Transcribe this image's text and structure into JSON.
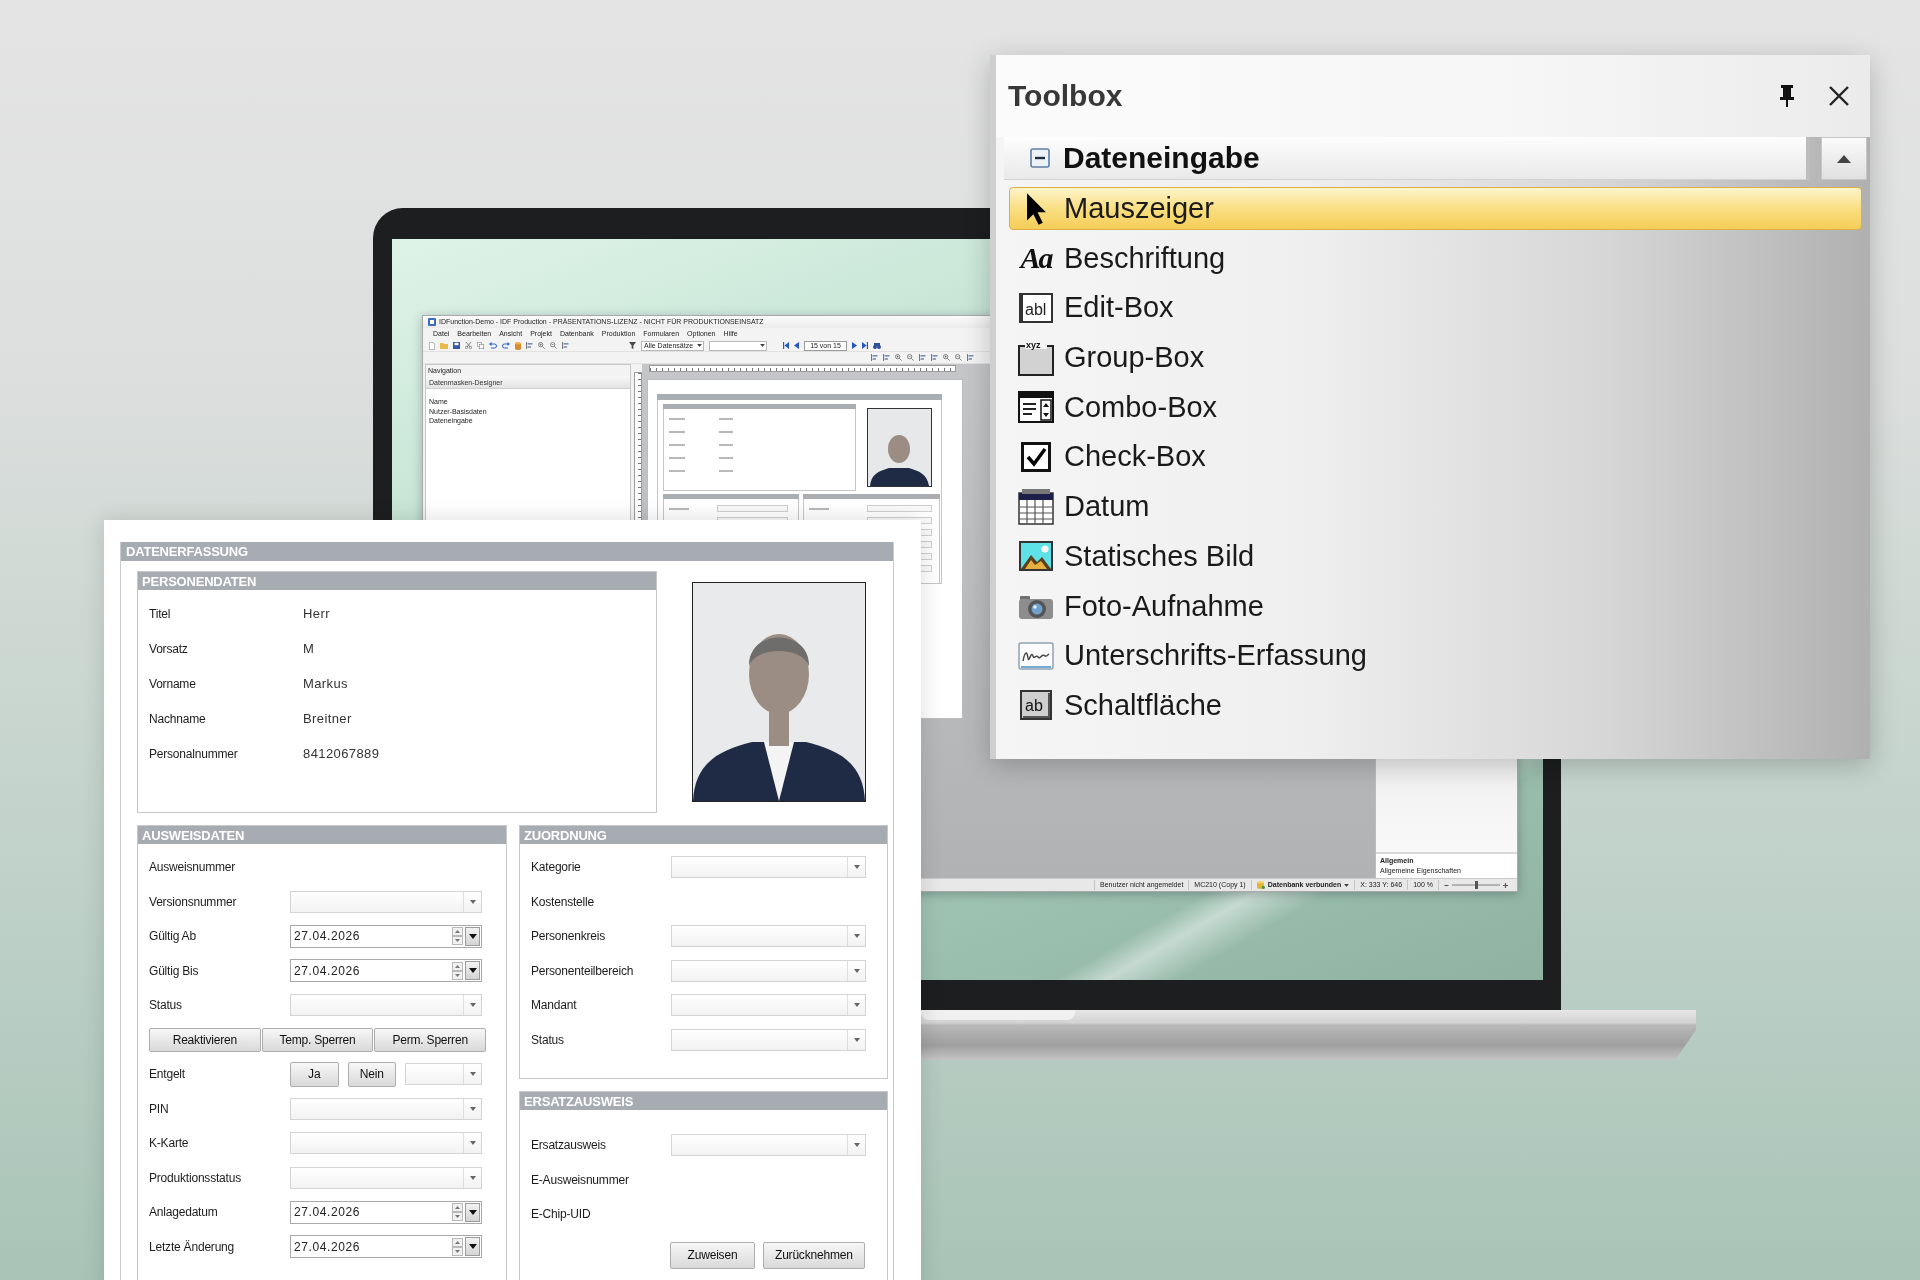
{
  "app_window": {
    "title": "IDFunction-Demo - IDF Production - PRÄSENTATIONS-LIZENZ - NICHT FÜR PRODUKTIONSEINSATZ",
    "menu": [
      "Datei",
      "Bearbeiten",
      "Ansicht",
      "Projekt",
      "Datenbank",
      "Produktion",
      "Formularen",
      "Optionen",
      "Hilfe"
    ],
    "toolbar": {
      "filter": "Alle Datensätze",
      "record_position": "15 von 15"
    },
    "navigation": {
      "title": "Navigation",
      "designer_title": "Datenmasken-Designer",
      "items": [
        "Name",
        "Nutzer-Basisdaten",
        "Dateneingabe"
      ]
    },
    "properties": {
      "title": "Allgemein",
      "description": "Allgemeine Eigenschaften"
    },
    "status_bar": {
      "items": [
        {
          "kind": "text",
          "text": "Benutzer nicht angemeldet"
        },
        {
          "kind": "text",
          "text": "MC210 (Copy 1)"
        },
        {
          "kind": "connection",
          "text": "Datenbank verbunden"
        },
        {
          "kind": "text",
          "text": "X: 333 Y: 646"
        },
        {
          "kind": "text",
          "text": "100 %"
        }
      ],
      "zoom": {
        "level": 0.5
      }
    }
  },
  "form": {
    "title": "DATENERFASSUNG",
    "personendaten": {
      "title": "PERSONENDATEN",
      "fields": [
        {
          "label": "Titel",
          "value": "Herr"
        },
        {
          "label": "Vorsatz",
          "value": "M"
        },
        {
          "label": "Vorname",
          "value": "Markus"
        },
        {
          "label": "Nachname",
          "value": "Breitner"
        },
        {
          "label": "Personalnummer",
          "value": "8412067889"
        }
      ]
    },
    "ausweisdaten": {
      "title": "AUSWEISDATEN",
      "rows": [
        {
          "kind": "text",
          "label": "Ausweisnummer"
        },
        {
          "kind": "combo",
          "label": "Versionsnummer"
        },
        {
          "kind": "date",
          "label": "Gültig Ab",
          "value": "27.04.2026"
        },
        {
          "kind": "date",
          "label": "Gültig Bis",
          "value": "27.04.2026"
        },
        {
          "kind": "combo",
          "label": "Status"
        },
        {
          "kind": "buttons",
          "buttons": [
            "Reaktivieren",
            "Temp. Sperren",
            "Perm. Sperren"
          ]
        },
        {
          "kind": "choice",
          "label": "Entgelt",
          "buttons": [
            "Ja",
            "Nein"
          ]
        },
        {
          "kind": "combo",
          "label": "PIN"
        },
        {
          "kind": "combo",
          "label": "K-Karte"
        },
        {
          "kind": "combo",
          "label": "Produktionsstatus"
        },
        {
          "kind": "date",
          "label": "Anlagedatum",
          "value": "27.04.2026"
        },
        {
          "kind": "date",
          "label": "Letzte Änderung",
          "value": "27.04.2026"
        }
      ]
    },
    "zuordnung": {
      "title": "ZUORDNUNG",
      "rows": [
        {
          "kind": "combo",
          "label": "Kategorie"
        },
        {
          "kind": "text",
          "label": "Kostenstelle"
        },
        {
          "kind": "combo",
          "label": "Personenkreis"
        },
        {
          "kind": "combo",
          "label": "Personenteilbereich"
        },
        {
          "kind": "combo",
          "label": "Mandant"
        },
        {
          "kind": "combo",
          "label": "Status"
        }
      ]
    },
    "ersatzausweis": {
      "title": "ERSATZAUSWEIS",
      "rows": [
        {
          "kind": "combo",
          "label": "Ersatzausweis"
        },
        {
          "kind": "text",
          "label": "E-Ausweisnummer"
        },
        {
          "kind": "text",
          "label": "E-Chip-UID"
        }
      ],
      "buttons": [
        "Zuweisen",
        "Zurücknehmen"
      ]
    }
  },
  "toolbox": {
    "title": "Toolbox",
    "group": {
      "label": "Dateneingabe",
      "expanded": true
    },
    "items": [
      {
        "kind": "pointer",
        "label": "Mauszeiger",
        "selected": true
      },
      {
        "kind": "label",
        "label": "Beschriftung",
        "icon_text": "Aa",
        "selected": false
      },
      {
        "kind": "edit",
        "label": "Edit-Box",
        "icon_text": "abl",
        "selected": false
      },
      {
        "kind": "group",
        "label": "Group-Box",
        "icon_text": "xyz",
        "selected": false
      },
      {
        "kind": "combo",
        "label": "Combo-Box",
        "selected": false
      },
      {
        "kind": "check",
        "label": "Check-Box",
        "selected": false
      },
      {
        "kind": "date",
        "label": "Datum",
        "selected": false
      },
      {
        "kind": "image",
        "label": "Statisches Bild",
        "selected": false
      },
      {
        "kind": "camera",
        "label": "Foto-Aufnahme",
        "selected": false
      },
      {
        "kind": "signature",
        "label": "Unterschrifts-Erfassung",
        "selected": false
      },
      {
        "kind": "button",
        "label": "Schaltfläche",
        "icon_text": "ab",
        "selected": false
      }
    ]
  }
}
